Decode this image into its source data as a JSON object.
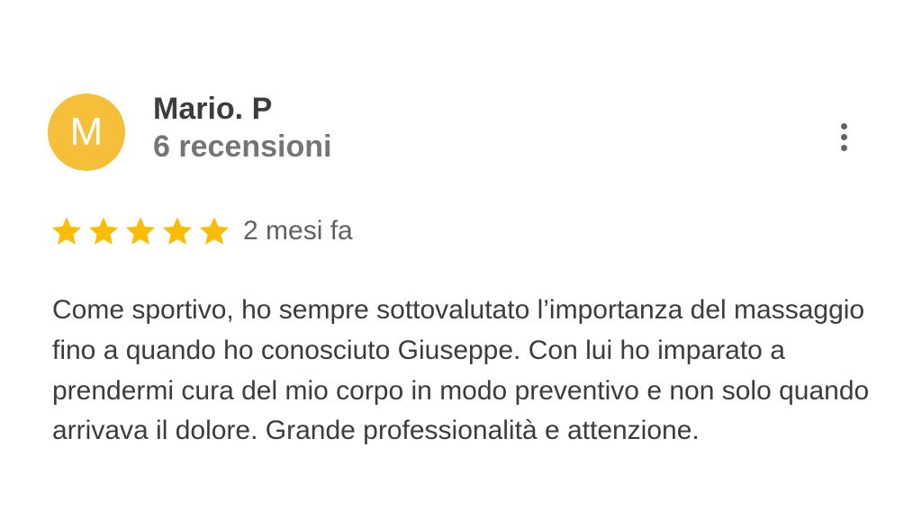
{
  "review": {
    "avatar_letter": "M",
    "avatar_color": "#F6BF3A",
    "author_name": "Mario. P",
    "review_count": "6 recensioni",
    "rating": 5,
    "max_rating": 5,
    "star_color": "#FBBC04",
    "time_ago": "2 mesi fa",
    "text": "Come sportivo, ho sempre sottovalutato l’importanza del massaggio fino a quando ho conosciuto Giuseppe. Con lui ho imparato a prendermi cura del mio corpo in modo preventivo e non solo quando arrivava il dolore. Grande professionalità e attenzione.",
    "more_icon": "more-vert-icon"
  }
}
